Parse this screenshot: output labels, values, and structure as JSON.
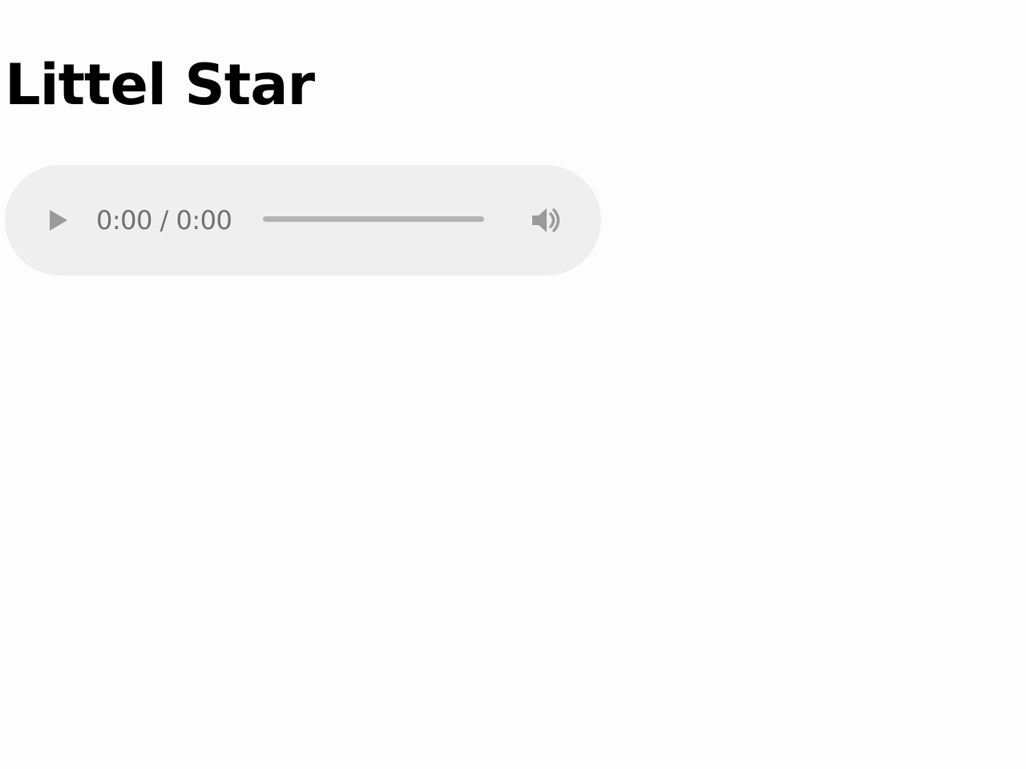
{
  "page": {
    "title": "Littel Star"
  },
  "audio_player": {
    "current_time": "0:00",
    "separator": " / ",
    "duration": "0:00",
    "progress": 0,
    "controls": {
      "play_icon": "play-icon",
      "volume_icon": "volume-icon"
    },
    "colors": {
      "background": "#efefef",
      "control": "#9a9a9a",
      "track": "#b4b4b4",
      "time_text": "#6f6f6f"
    }
  }
}
